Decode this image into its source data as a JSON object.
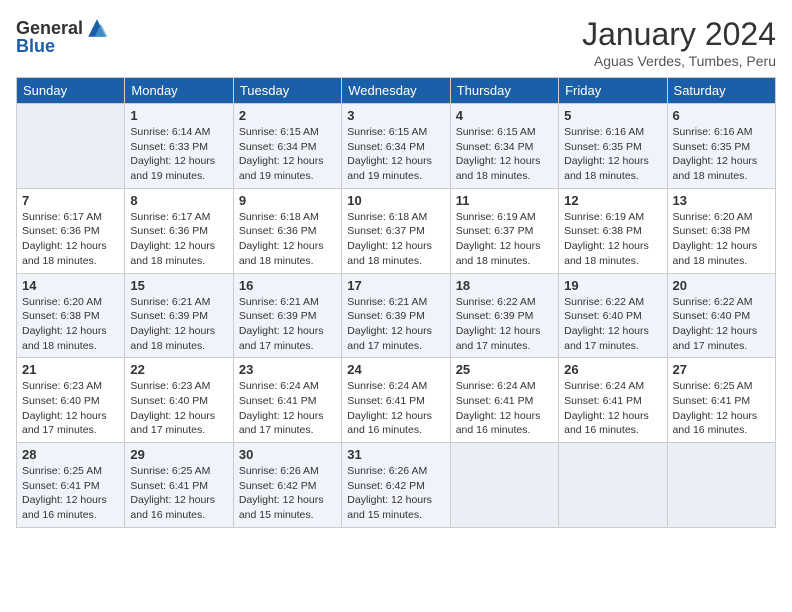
{
  "header": {
    "logo_general": "General",
    "logo_blue": "Blue",
    "month_title": "January 2024",
    "subtitle": "Aguas Verdes, Tumbes, Peru"
  },
  "weekdays": [
    "Sunday",
    "Monday",
    "Tuesday",
    "Wednesday",
    "Thursday",
    "Friday",
    "Saturday"
  ],
  "weeks": [
    [
      {
        "day": "",
        "info": ""
      },
      {
        "day": "1",
        "info": "Sunrise: 6:14 AM\nSunset: 6:33 PM\nDaylight: 12 hours\nand 19 minutes."
      },
      {
        "day": "2",
        "info": "Sunrise: 6:15 AM\nSunset: 6:34 PM\nDaylight: 12 hours\nand 19 minutes."
      },
      {
        "day": "3",
        "info": "Sunrise: 6:15 AM\nSunset: 6:34 PM\nDaylight: 12 hours\nand 19 minutes."
      },
      {
        "day": "4",
        "info": "Sunrise: 6:15 AM\nSunset: 6:34 PM\nDaylight: 12 hours\nand 18 minutes."
      },
      {
        "day": "5",
        "info": "Sunrise: 6:16 AM\nSunset: 6:35 PM\nDaylight: 12 hours\nand 18 minutes."
      },
      {
        "day": "6",
        "info": "Sunrise: 6:16 AM\nSunset: 6:35 PM\nDaylight: 12 hours\nand 18 minutes."
      }
    ],
    [
      {
        "day": "7",
        "info": "Sunrise: 6:17 AM\nSunset: 6:36 PM\nDaylight: 12 hours\nand 18 minutes."
      },
      {
        "day": "8",
        "info": "Sunrise: 6:17 AM\nSunset: 6:36 PM\nDaylight: 12 hours\nand 18 minutes."
      },
      {
        "day": "9",
        "info": "Sunrise: 6:18 AM\nSunset: 6:36 PM\nDaylight: 12 hours\nand 18 minutes."
      },
      {
        "day": "10",
        "info": "Sunrise: 6:18 AM\nSunset: 6:37 PM\nDaylight: 12 hours\nand 18 minutes."
      },
      {
        "day": "11",
        "info": "Sunrise: 6:19 AM\nSunset: 6:37 PM\nDaylight: 12 hours\nand 18 minutes."
      },
      {
        "day": "12",
        "info": "Sunrise: 6:19 AM\nSunset: 6:38 PM\nDaylight: 12 hours\nand 18 minutes."
      },
      {
        "day": "13",
        "info": "Sunrise: 6:20 AM\nSunset: 6:38 PM\nDaylight: 12 hours\nand 18 minutes."
      }
    ],
    [
      {
        "day": "14",
        "info": "Sunrise: 6:20 AM\nSunset: 6:38 PM\nDaylight: 12 hours\nand 18 minutes."
      },
      {
        "day": "15",
        "info": "Sunrise: 6:21 AM\nSunset: 6:39 PM\nDaylight: 12 hours\nand 18 minutes."
      },
      {
        "day": "16",
        "info": "Sunrise: 6:21 AM\nSunset: 6:39 PM\nDaylight: 12 hours\nand 17 minutes."
      },
      {
        "day": "17",
        "info": "Sunrise: 6:21 AM\nSunset: 6:39 PM\nDaylight: 12 hours\nand 17 minutes."
      },
      {
        "day": "18",
        "info": "Sunrise: 6:22 AM\nSunset: 6:39 PM\nDaylight: 12 hours\nand 17 minutes."
      },
      {
        "day": "19",
        "info": "Sunrise: 6:22 AM\nSunset: 6:40 PM\nDaylight: 12 hours\nand 17 minutes."
      },
      {
        "day": "20",
        "info": "Sunrise: 6:22 AM\nSunset: 6:40 PM\nDaylight: 12 hours\nand 17 minutes."
      }
    ],
    [
      {
        "day": "21",
        "info": "Sunrise: 6:23 AM\nSunset: 6:40 PM\nDaylight: 12 hours\nand 17 minutes."
      },
      {
        "day": "22",
        "info": "Sunrise: 6:23 AM\nSunset: 6:40 PM\nDaylight: 12 hours\nand 17 minutes."
      },
      {
        "day": "23",
        "info": "Sunrise: 6:24 AM\nSunset: 6:41 PM\nDaylight: 12 hours\nand 17 minutes."
      },
      {
        "day": "24",
        "info": "Sunrise: 6:24 AM\nSunset: 6:41 PM\nDaylight: 12 hours\nand 16 minutes."
      },
      {
        "day": "25",
        "info": "Sunrise: 6:24 AM\nSunset: 6:41 PM\nDaylight: 12 hours\nand 16 minutes."
      },
      {
        "day": "26",
        "info": "Sunrise: 6:24 AM\nSunset: 6:41 PM\nDaylight: 12 hours\nand 16 minutes."
      },
      {
        "day": "27",
        "info": "Sunrise: 6:25 AM\nSunset: 6:41 PM\nDaylight: 12 hours\nand 16 minutes."
      }
    ],
    [
      {
        "day": "28",
        "info": "Sunrise: 6:25 AM\nSunset: 6:41 PM\nDaylight: 12 hours\nand 16 minutes."
      },
      {
        "day": "29",
        "info": "Sunrise: 6:25 AM\nSunset: 6:41 PM\nDaylight: 12 hours\nand 16 minutes."
      },
      {
        "day": "30",
        "info": "Sunrise: 6:26 AM\nSunset: 6:42 PM\nDaylight: 12 hours\nand 15 minutes."
      },
      {
        "day": "31",
        "info": "Sunrise: 6:26 AM\nSunset: 6:42 PM\nDaylight: 12 hours\nand 15 minutes."
      },
      {
        "day": "",
        "info": ""
      },
      {
        "day": "",
        "info": ""
      },
      {
        "day": "",
        "info": ""
      }
    ]
  ]
}
